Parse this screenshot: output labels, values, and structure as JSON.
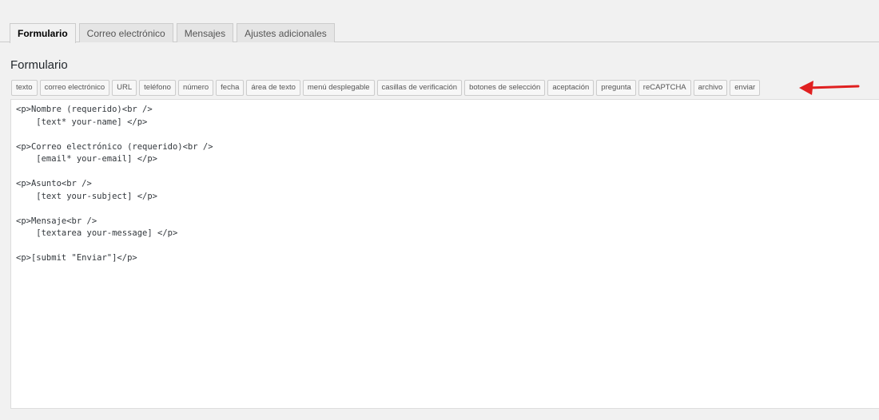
{
  "tabs": [
    {
      "label": "Formulario",
      "active": true
    },
    {
      "label": "Correo electrónico",
      "active": false
    },
    {
      "label": "Mensajes",
      "active": false
    },
    {
      "label": "Ajustes adicionales",
      "active": false
    }
  ],
  "panel": {
    "title": "Formulario"
  },
  "tag_buttons": [
    "texto",
    "correo electrónico",
    "URL",
    "teléfono",
    "número",
    "fecha",
    "área de texto",
    "menú desplegable",
    "casillas de verificación",
    "botones de selección",
    "aceptación",
    "pregunta",
    "reCAPTCHA",
    "archivo",
    "enviar"
  ],
  "editor": {
    "content": "<p>Nombre (requerido)<br />\n    [text* your-name] </p>\n\n<p>Correo electrónico (requerido)<br />\n    [email* your-email] </p>\n\n<p>Asunto<br />\n    [text your-subject] </p>\n\n<p>Mensaje<br />\n    [textarea your-message] </p>\n\n<p>[submit \"Enviar\"]</p>"
  },
  "annotation": {
    "arrow_color": "#e02020",
    "arrow_icon": "arrow-left-icon"
  }
}
